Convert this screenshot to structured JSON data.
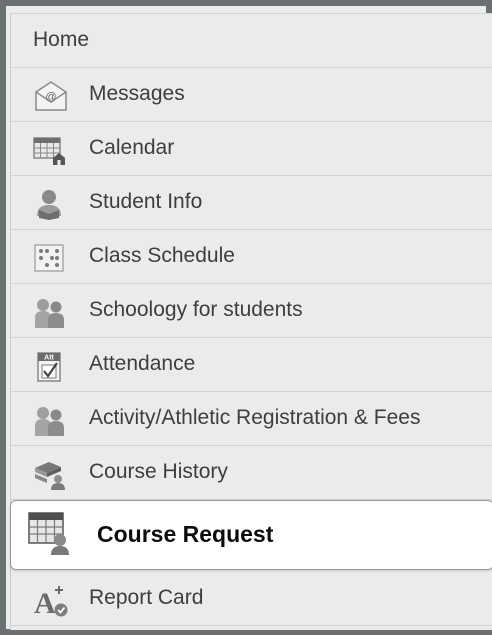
{
  "menu": {
    "items": [
      {
        "label": "Home",
        "icon": "home"
      },
      {
        "label": "Messages",
        "icon": "envelope-icon"
      },
      {
        "label": "Calendar",
        "icon": "calendar-icon"
      },
      {
        "label": "Student Info",
        "icon": "student-icon"
      },
      {
        "label": "Class Schedule",
        "icon": "schedule-icon"
      },
      {
        "label": "Schoology for students",
        "icon": "people-icon"
      },
      {
        "label": "Attendance",
        "icon": "attendance-icon"
      },
      {
        "label": "Activity/Athletic Registration & Fees",
        "icon": "people-icon"
      },
      {
        "label": "Course History",
        "icon": "books-icon"
      },
      {
        "label": "Course Request",
        "icon": "course-request-icon",
        "active": true
      },
      {
        "label": "Report Card",
        "icon": "grade-icon"
      }
    ],
    "attendance_badge": "Att",
    "colors": {
      "active_bg": "#ffffff",
      "item_bg": "#ebebeb",
      "text": "#3e3e3e",
      "active_text": "#0c0c0c"
    }
  }
}
